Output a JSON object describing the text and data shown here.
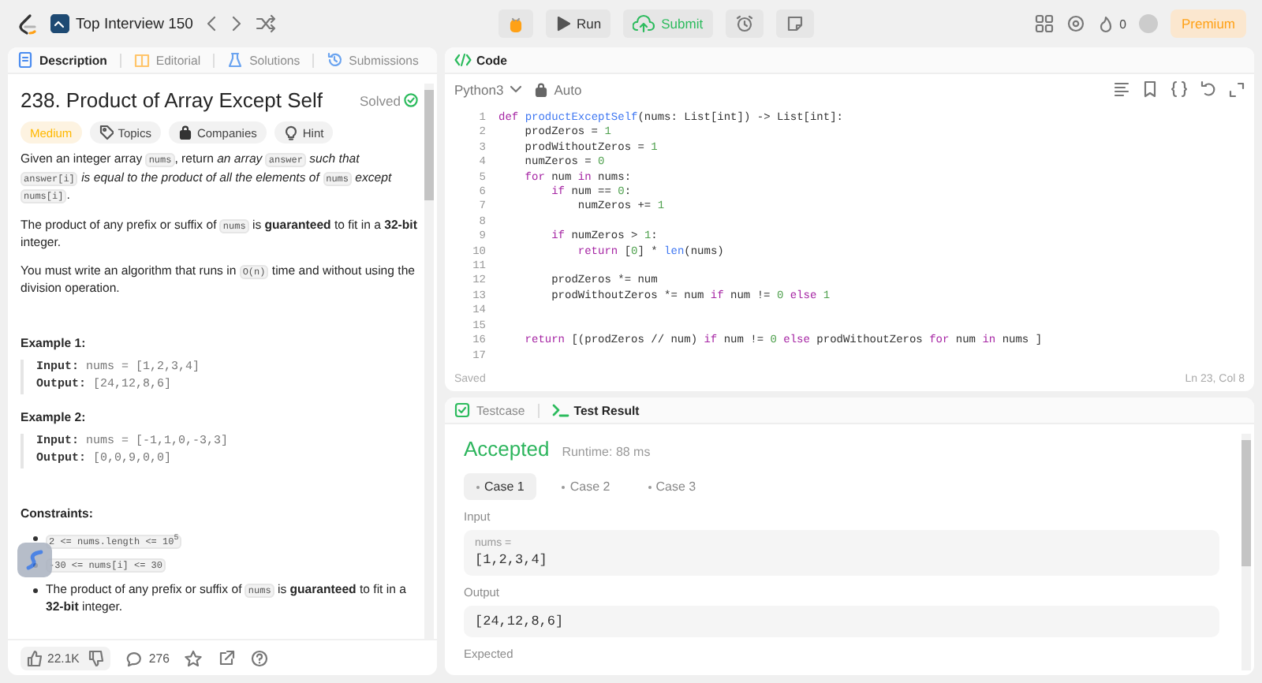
{
  "top_bar": {
    "list_title": "Top Interview 150",
    "run_label": "Run",
    "submit_label": "Submit",
    "streak_count": "0",
    "premium_label": "Premium"
  },
  "description_panel": {
    "tabs": [
      {
        "label": "Description",
        "kind": "description",
        "selected": true
      },
      {
        "label": "Editorial",
        "kind": "editorial",
        "selected": false
      },
      {
        "label": "Solutions",
        "kind": "solutions",
        "selected": false
      },
      {
        "label": "Submissions",
        "kind": "submissions",
        "selected": false
      }
    ],
    "title": "238. Product of Array Except Self",
    "status": "Solved",
    "tags": [
      {
        "label": "Medium",
        "kind": "difficulty"
      },
      {
        "label": "Topics",
        "kind": "topics"
      },
      {
        "label": "Companies",
        "kind": "companies"
      },
      {
        "label": "Hint",
        "kind": "hint"
      }
    ],
    "paragraphs": [
      [
        {
          "kind": "text",
          "text": "Given an integer array "
        },
        {
          "kind": "code",
          "text": "nums"
        },
        {
          "kind": "text",
          "text": ", return *an array* "
        },
        {
          "kind": "code",
          "text": "answer"
        },
        {
          "kind": "text",
          "text": " *such that* "
        },
        {
          "kind": "code",
          "text": "answer[i]"
        },
        {
          "kind": "text",
          "text": " *is equal to the product of all the elements of* "
        },
        {
          "kind": "code",
          "text": "nums"
        },
        {
          "kind": "text",
          "text": " *except* "
        },
        {
          "kind": "code",
          "text": "nums[i]"
        },
        {
          "kind": "text",
          "text": "."
        }
      ],
      [
        {
          "kind": "text",
          "text": "The product of any prefix or suffix of "
        },
        {
          "kind": "code",
          "text": "nums"
        },
        {
          "kind": "text",
          "text": " is **guaranteed** to fit in a **32-bit** integer."
        }
      ],
      [
        {
          "kind": "text",
          "text": "You must write an algorithm that runs in "
        },
        {
          "kind": "code",
          "text": "O(n)"
        },
        {
          "kind": "text",
          "text": " time and without using the division operation."
        }
      ]
    ],
    "examples": [
      {
        "heading": "Example 1:",
        "input_label": "Input:",
        "input": "nums = [1,2,3,4]",
        "output_label": "Output:",
        "output": "[24,12,8,6]"
      },
      {
        "heading": "Example 2:",
        "input_label": "Input:",
        "input": "nums = [-1,1,0,-3,3]",
        "output_label": "Output:",
        "output": "[0,0,9,0,0]"
      }
    ],
    "constraints_heading": "Constraints:",
    "constraints": [
      [
        {
          "kind": "code",
          "text": "2 <= nums.length <= 10$^{5}$"
        }
      ],
      [
        {
          "kind": "code",
          "text": "-30 <= nums[i] <= 30"
        }
      ],
      [
        {
          "kind": "text",
          "text": "The product of any prefix or suffix of "
        },
        {
          "kind": "code",
          "text": "nums"
        },
        {
          "kind": "text",
          "text": " is **guaranteed** to fit in a **32-bit** integer."
        }
      ]
    ],
    "footer": {
      "likes": "22.1K",
      "comments": "276"
    }
  },
  "code_panel": {
    "title": "Code",
    "language": "Python3",
    "mode": "Auto",
    "lines": [
      {
        "number": "1",
        "tokens": [
          {
            "kind": "kw",
            "text": "def "
          },
          {
            "kind": "fn",
            "text": "productExceptSelf"
          },
          {
            "kind": "plain",
            "text": "(nums: List["
          },
          {
            "kind": "type",
            "text": "int"
          },
          {
            "kind": "plain",
            "text": "]) -> List["
          },
          {
            "kind": "type",
            "text": "int"
          },
          {
            "kind": "plain",
            "text": "]:"
          }
        ]
      },
      {
        "number": "2",
        "tokens": [
          {
            "kind": "plain",
            "text": "    prodZeros = "
          },
          {
            "kind": "num",
            "text": "1"
          }
        ]
      },
      {
        "number": "3",
        "tokens": [
          {
            "kind": "plain",
            "text": "    prodWithoutZeros = "
          },
          {
            "kind": "num",
            "text": "1"
          }
        ]
      },
      {
        "number": "4",
        "tokens": [
          {
            "kind": "plain",
            "text": "    numZeros = "
          },
          {
            "kind": "num",
            "text": "0"
          }
        ]
      },
      {
        "number": "5",
        "tokens": [
          {
            "kind": "kw",
            "text": "    for"
          },
          {
            "kind": "plain",
            "text": " num "
          },
          {
            "kind": "kw",
            "text": "in"
          },
          {
            "kind": "plain",
            "text": " nums:"
          }
        ]
      },
      {
        "number": "6",
        "tokens": [
          {
            "kind": "kw",
            "text": "        if"
          },
          {
            "kind": "plain",
            "text": " num == "
          },
          {
            "kind": "num",
            "text": "0"
          },
          {
            "kind": "plain",
            "text": ":"
          }
        ]
      },
      {
        "number": "7",
        "tokens": [
          {
            "kind": "plain",
            "text": "            numZeros += "
          },
          {
            "kind": "num",
            "text": "1"
          }
        ]
      },
      {
        "number": "8"
      },
      {
        "number": "9",
        "tokens": [
          {
            "kind": "kw",
            "text": "        if"
          },
          {
            "kind": "plain",
            "text": " numZeros > "
          },
          {
            "kind": "num",
            "text": "1"
          },
          {
            "kind": "plain",
            "text": ":"
          }
        ]
      },
      {
        "number": "10",
        "tokens": [
          {
            "kind": "kw",
            "text": "            return"
          },
          {
            "kind": "plain",
            "text": " ["
          },
          {
            "kind": "num",
            "text": "0"
          },
          {
            "kind": "plain",
            "text": "] * "
          },
          {
            "kind": "fn",
            "text": "len"
          },
          {
            "kind": "plain",
            "text": "(nums)"
          }
        ]
      },
      {
        "number": "11"
      },
      {
        "number": "12",
        "tokens": [
          {
            "kind": "plain",
            "text": "        prodZeros *= num"
          }
        ]
      },
      {
        "number": "13",
        "tokens": [
          {
            "kind": "plain",
            "text": "        prodWithoutZeros *= num "
          },
          {
            "kind": "kw",
            "text": "if"
          },
          {
            "kind": "plain",
            "text": " num != "
          },
          {
            "kind": "num",
            "text": "0"
          },
          {
            "kind": "kw",
            "text": " else "
          },
          {
            "kind": "num",
            "text": "1"
          }
        ]
      },
      {
        "number": "14"
      },
      {
        "number": "15"
      },
      {
        "number": "16",
        "tokens": [
          {
            "kind": "kw",
            "text": "    return"
          },
          {
            "kind": "plain",
            "text": " [(prodZeros // num) "
          },
          {
            "kind": "kw",
            "text": "if"
          },
          {
            "kind": "plain",
            "text": " num != "
          },
          {
            "kind": "num",
            "text": "0"
          },
          {
            "kind": "kw",
            "text": " else"
          },
          {
            "kind": "plain",
            "text": " prodWithoutZeros "
          },
          {
            "kind": "kw",
            "text": "for"
          },
          {
            "kind": "plain",
            "text": " num "
          },
          {
            "kind": "kw",
            "text": "in"
          },
          {
            "kind": "plain",
            "text": " nums ]"
          }
        ]
      },
      {
        "number": "17"
      }
    ],
    "status": "Saved",
    "cursor": "Ln 23, Col 8"
  },
  "test_panel": {
    "tabs": [
      {
        "label": "Testcase",
        "kind": "testcase",
        "selected": false
      },
      {
        "label": "Test Result",
        "kind": "result",
        "selected": true
      }
    ],
    "verdict": "Accepted",
    "runtime": "Runtime: 88 ms",
    "cases": [
      {
        "label": "Case 1",
        "selected": true
      },
      {
        "label": "Case 2",
        "selected": false
      },
      {
        "label": "Case 3",
        "selected": false
      }
    ],
    "input_label": "Input",
    "input_name": "nums =",
    "input_value": "[1,2,3,4]",
    "output_label": "Output",
    "output_value": "[24,12,8,6]",
    "expected_label": "Expected"
  }
}
